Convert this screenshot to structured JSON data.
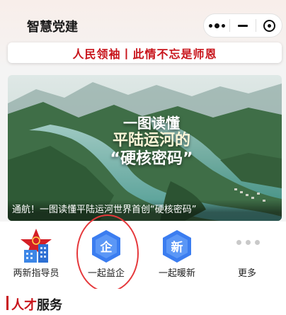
{
  "app": {
    "title": "智慧党建"
  },
  "capsule": {
    "more_icon": "more-dots-icon",
    "minimize_icon": "minus-icon",
    "close_icon": "target-icon"
  },
  "slogan": "人民领袖丨此情不忘是师恩",
  "banner": {
    "headline_line1": "一图读懂",
    "headline_line2": "平陆运河的",
    "headline_line3": "“硬核密码”",
    "caption": "通航！一图读懂平陆运河世界首创“硬核密码”"
  },
  "menu": {
    "items": [
      {
        "label": "两新指导员",
        "icon": "party-building-icon"
      },
      {
        "label": "一起益企",
        "icon": "enterprise-badge-icon",
        "glyph": "企"
      },
      {
        "label": "一起暖新",
        "icon": "new-badge-icon",
        "glyph": "新"
      },
      {
        "label": "更多",
        "icon": "more-dots-icon"
      }
    ]
  },
  "section": {
    "title_accent": "人才",
    "title_rest": "服务"
  },
  "colors": {
    "brand_red": "#c8141b",
    "badge_blue": "#3b7df0",
    "highlight": "#e5383b"
  }
}
